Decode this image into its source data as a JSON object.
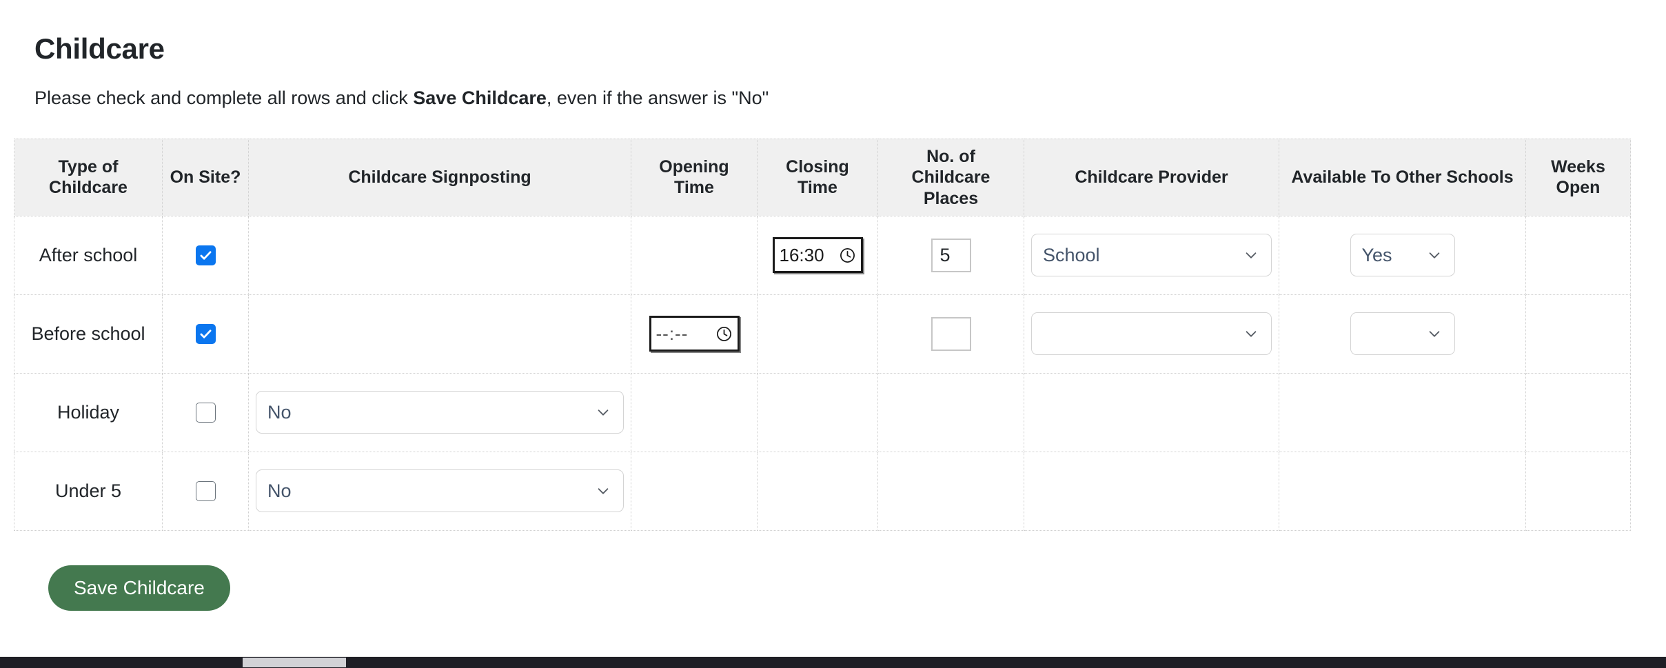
{
  "header": {
    "title": "Childcare",
    "instructions_before": "Please check and complete all rows and click ",
    "instructions_bold": "Save Childcare",
    "instructions_after": ", even if the answer is \"No\""
  },
  "table": {
    "columns": [
      {
        "key": "type",
        "label": "Type of Childcare"
      },
      {
        "key": "onsite",
        "label": "On Site?"
      },
      {
        "key": "signpost",
        "label": "Childcare Signposting"
      },
      {
        "key": "opening",
        "label": "Opening Time"
      },
      {
        "key": "closing",
        "label": "Closing Time"
      },
      {
        "key": "places",
        "label": "No. of Childcare Places"
      },
      {
        "key": "provider",
        "label": "Childcare Provider"
      },
      {
        "key": "available",
        "label": "Available To Other Schools"
      },
      {
        "key": "weeks",
        "label": "Weeks Open"
      }
    ],
    "rows": [
      {
        "type": "After school",
        "onsite_checked": true,
        "signposting": null,
        "opening_time": null,
        "closing_time": "16:30",
        "places": "5",
        "provider": "School",
        "available": "Yes",
        "weeks": ""
      },
      {
        "type": "Before school",
        "onsite_checked": true,
        "signposting": null,
        "opening_time": "--:--",
        "closing_time": null,
        "places": "",
        "provider": "",
        "available": "",
        "weeks": ""
      },
      {
        "type": "Holiday",
        "onsite_checked": false,
        "signposting": "No",
        "opening_time": null,
        "closing_time": null,
        "places": null,
        "provider": null,
        "available": null,
        "weeks": ""
      },
      {
        "type": "Under 5",
        "onsite_checked": false,
        "signposting": "No",
        "opening_time": null,
        "closing_time": null,
        "places": null,
        "provider": null,
        "available": null,
        "weeks": ""
      }
    ]
  },
  "actions": {
    "save_label": "Save Childcare"
  },
  "colors": {
    "save_button": "#44794f",
    "checkbox_checked": "#0b76ef",
    "header_background": "#f0f0f0",
    "text": "#212529",
    "select_text": "#44546a"
  },
  "icons": {
    "clock": "clock-icon",
    "chevron_down": "chevron-down-icon",
    "check": "check-icon"
  }
}
